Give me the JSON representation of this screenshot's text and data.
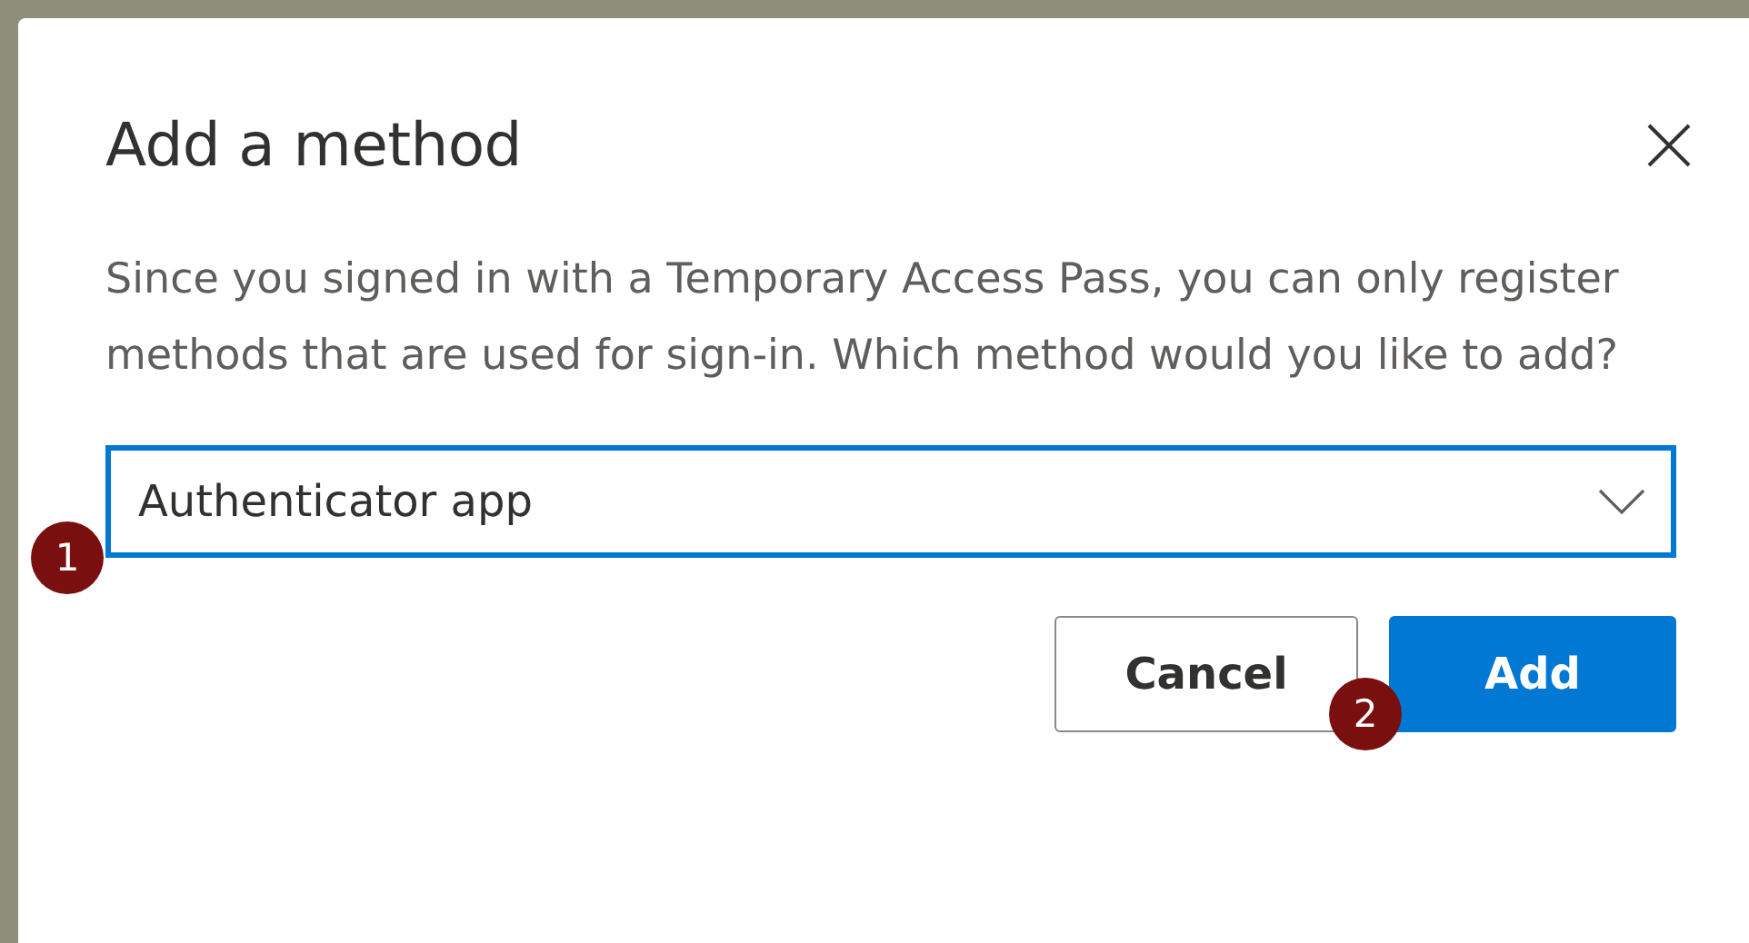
{
  "dialog": {
    "title": "Add a method",
    "description": "Since you signed in with a Temporary Access Pass, you can only register methods that are used for sign-in. Which method would you like to add?",
    "select": {
      "value": "Authenticator app",
      "focused": true
    },
    "buttons": [
      {
        "label": "Cancel",
        "kind": "secondary"
      },
      {
        "label": "Add",
        "kind": "primary"
      }
    ]
  },
  "step_badges": [
    {
      "label": "1"
    },
    {
      "label": "2"
    }
  ]
}
